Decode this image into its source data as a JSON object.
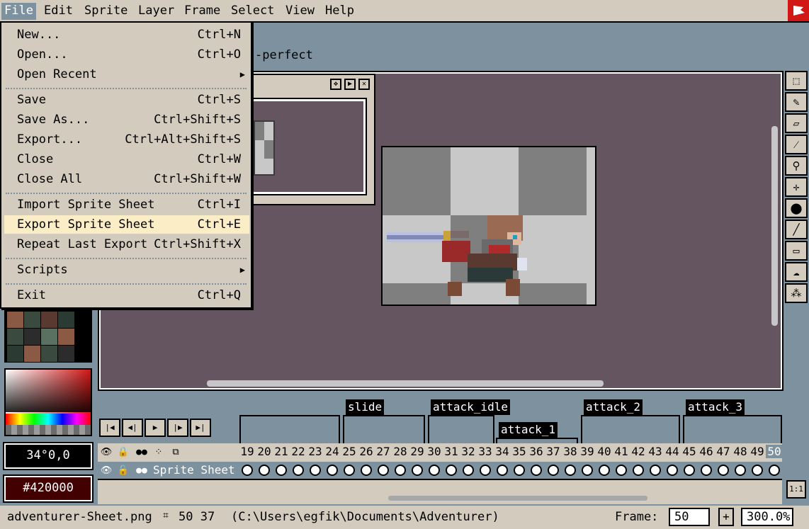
{
  "menubar": {
    "items": [
      "File",
      "Edit",
      "Sprite",
      "Layer",
      "Frame",
      "Select",
      "View",
      "Help"
    ]
  },
  "sprite_title": "-perfect",
  "file_menu": {
    "items": [
      {
        "label": "New...",
        "shortcut": "Ctrl+N"
      },
      {
        "label": "Open...",
        "shortcut": "Ctrl+O"
      },
      {
        "label": "Open Recent",
        "shortcut": ""
      },
      {
        "label": "Save",
        "shortcut": "Ctrl+S"
      },
      {
        "label": "Save As...",
        "shortcut": "Ctrl+Shift+S"
      },
      {
        "label": "Export...",
        "shortcut": "Ctrl+Alt+Shift+S"
      },
      {
        "label": "Close",
        "shortcut": "Ctrl+W"
      },
      {
        "label": "Close All",
        "shortcut": "Ctrl+Shift+W"
      },
      {
        "label": "Import Sprite Sheet",
        "shortcut": "Ctrl+I"
      },
      {
        "label": "Export Sprite Sheet",
        "shortcut": "Ctrl+E"
      },
      {
        "label": "Repeat Last Export",
        "shortcut": "Ctrl+Shift+X"
      },
      {
        "label": "Scripts",
        "shortcut": ""
      },
      {
        "label": "Exit",
        "shortcut": "Ctrl+Q"
      }
    ],
    "highlighted": "Export Sprite Sheet"
  },
  "tools": [
    "marquee-icon",
    "pencil-icon",
    "eraser-icon",
    "eyedropper-icon",
    "zoom-icon",
    "move-icon",
    "fill-icon",
    "line-icon",
    "rectangle-icon",
    "contour-icon",
    "spray-icon"
  ],
  "palette": {
    "colors": [
      "#8a5a44",
      "#3b4a3f",
      "#5a3a30",
      "#2c3a34",
      "#3b4a3f",
      "#2c2c2c",
      "#5a7060",
      "#8a5a44",
      "#2c3a34",
      "#8a5a44",
      "#3b4a3f",
      "#2c2c2c"
    ]
  },
  "color_values": {
    "hsv": "34°0,0",
    "hex": "#420000",
    "accent": "#420000"
  },
  "timeline": {
    "tags": [
      "slide",
      "attack_idle",
      "attack_1",
      "attack_2",
      "attack_3"
    ],
    "frames": [
      "19",
      "20",
      "21",
      "22",
      "23",
      "24",
      "25",
      "26",
      "27",
      "28",
      "29",
      "30",
      "31",
      "32",
      "33",
      "34",
      "35",
      "36",
      "37",
      "38",
      "39",
      "40",
      "41",
      "42",
      "43",
      "44",
      "45",
      "46",
      "47",
      "48",
      "49",
      "50"
    ],
    "layer_name": "Sprite Sheet",
    "one_to_one": "1:1"
  },
  "status": {
    "filename": "adventurer-Sheet.png",
    "size": "50 37",
    "path": "(C:\\Users\\egfik\\Documents\\Adventurer)",
    "frame_label": "Frame:",
    "frame_value": "50",
    "zoom_value": "300.0%",
    "plus_label": "+"
  }
}
